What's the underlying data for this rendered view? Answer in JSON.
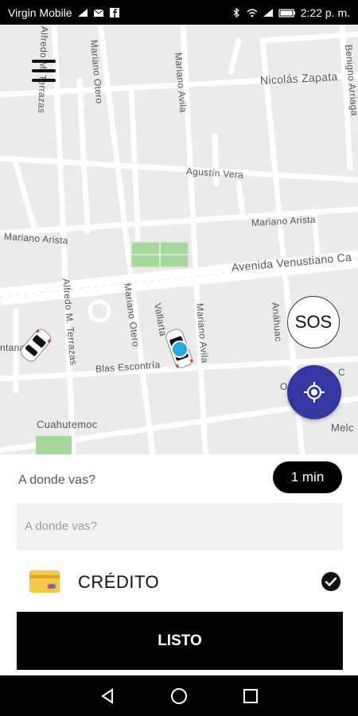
{
  "status_bar": {
    "carrier": "Virgin Mobile",
    "time": "2:22 p. m."
  },
  "map": {
    "streets": {
      "nicolas_zapata": "Nicolás Zapata",
      "agustin_vera": "Agustín Vera",
      "mariano_arista_right": "Mariano Arista",
      "mariano_arista_left": "Mariano Arista",
      "avenida_venustiano": "Avenida Venustiano Ca",
      "blas_escontria": "Blas Escontría",
      "cuahutemoc": "Cuahutemoc",
      "alfredo_terrazas_top": "Alfredo M. Terrazas",
      "alfredo_terrazas_bottom": "Alfredo M. Terrazas",
      "mariano_otero_top": "Mariano Otero",
      "mariano_otero_bottom": "Mariano Otero",
      "mariano_avila_top": "Mariano Avila",
      "mariano_avila_bottom": "Mariano Avila",
      "vallarta": "Vallarta",
      "benigno_arriaga": "Benigno Arriaga",
      "anahuac": "Anáhuac",
      "ntana": "ntana",
      "melc": "Melc",
      "o_partial": "O"
    },
    "sos_label": "SOS"
  },
  "sheet": {
    "destination_label": "A donde vas?",
    "eta": "1 min",
    "destination_placeholder": "A donde vas?",
    "destination_value": "",
    "payment_method": "CRÉDITO",
    "confirm_label": "LISTO"
  },
  "colors": {
    "accent": "#3437a0",
    "map_bg": "#ebebeb",
    "road": "#ffffff",
    "park": "#a6d79a",
    "card": "#f3c94a"
  },
  "icons": {
    "menu": "hamburger-icon",
    "locate": "crosshair-icon",
    "payment": "credit-card-icon",
    "selected": "check-circle-icon",
    "nav_back": "triangle-back-icon",
    "nav_home": "circle-home-icon",
    "nav_recents": "square-recents-icon"
  }
}
